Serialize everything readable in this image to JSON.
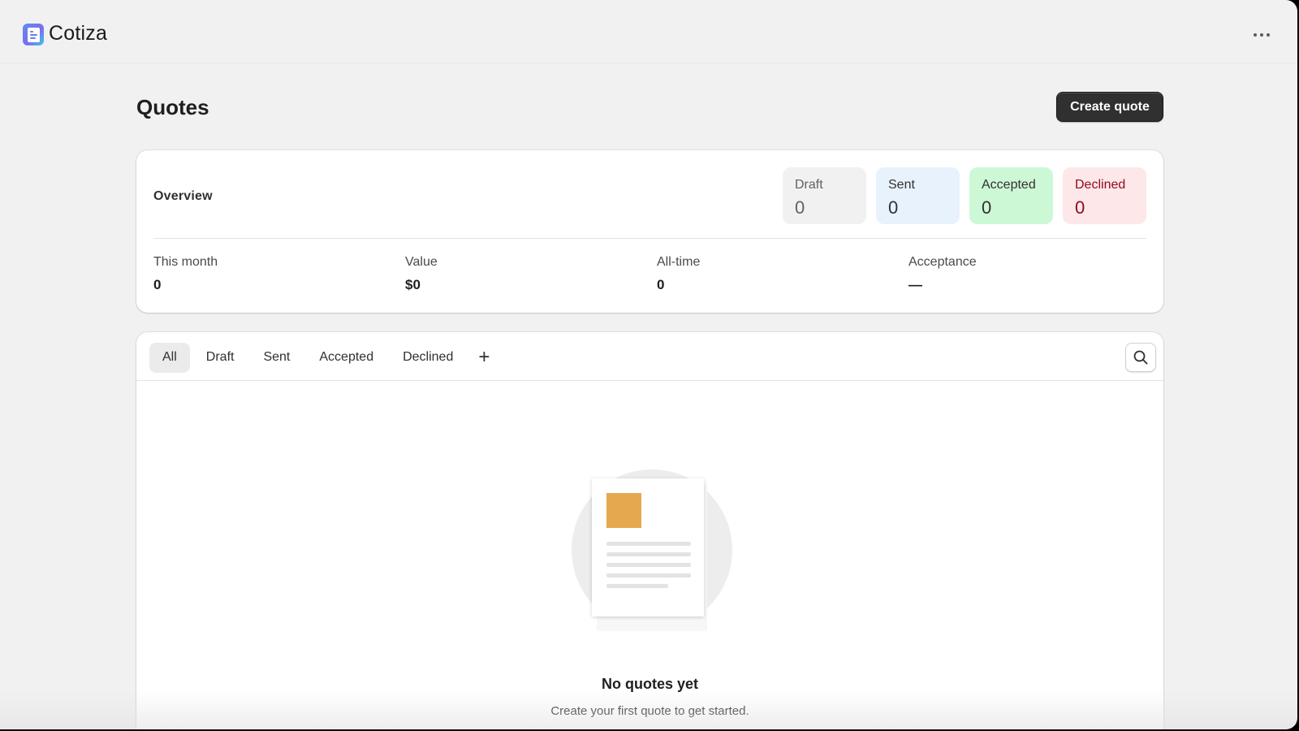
{
  "app": {
    "title": "Cotiza",
    "logo_icon": "document-icon",
    "menu_icon": "more-horizontal-icon"
  },
  "page": {
    "title": "Quotes",
    "create_label": "Create quote"
  },
  "overview": {
    "label": "Overview",
    "statuses": [
      {
        "label": "Draft",
        "count": "0",
        "bg": "#f1f1f1",
        "color": "#616161"
      },
      {
        "label": "Sent",
        "count": "0",
        "bg": "#e8f2fd",
        "color": "#303030"
      },
      {
        "label": "Accepted",
        "count": "0",
        "bg": "#cdf8d6",
        "color": "#303030"
      },
      {
        "label": "Declined",
        "count": "0",
        "bg": "#fde7e9",
        "color": "#8e0b21"
      }
    ],
    "metrics": [
      {
        "label": "This month",
        "value": "0"
      },
      {
        "label": "Value",
        "value": "$0"
      },
      {
        "label": "All-time",
        "value": "0"
      },
      {
        "label": "Acceptance",
        "value": "—"
      }
    ]
  },
  "list": {
    "tabs": [
      "All",
      "Draft",
      "Sent",
      "Accepted",
      "Declined"
    ],
    "active_tab": "All",
    "add_tab_label": "+",
    "search_icon": "search-icon",
    "empty": {
      "title": "No quotes yet",
      "description": "Create your first quote to get started."
    }
  },
  "colors": {
    "accent_button": "#303030",
    "background": "#f1f1f1",
    "illustration_accent": "#e5a84f"
  }
}
